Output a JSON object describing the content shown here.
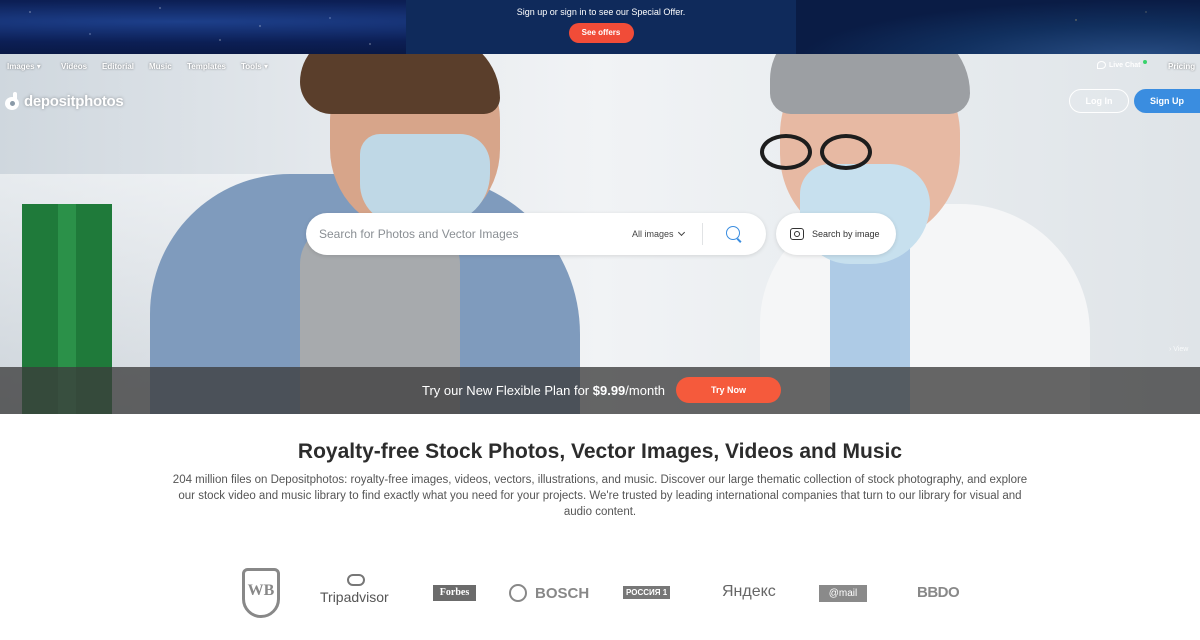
{
  "promo": {
    "text": "Sign up or sign in to see our Special Offer.",
    "button_label": "See offers"
  },
  "nav": {
    "items": [
      {
        "label": "Images",
        "dropdown": true
      },
      {
        "label": "Videos",
        "dropdown": false
      },
      {
        "label": "Editorial",
        "dropdown": false
      },
      {
        "label": "Music",
        "dropdown": false
      },
      {
        "label": "Templates",
        "dropdown": false
      },
      {
        "label": "Tools",
        "dropdown": true
      }
    ],
    "live_chat": "Live Chat",
    "pricing": "Pricing"
  },
  "brand": {
    "name": "depositphotos"
  },
  "auth": {
    "login": "Log In",
    "signup": "Sign Up"
  },
  "search": {
    "placeholder": "Search for Photos and Vector Images",
    "filter_value": "All images",
    "by_image_label": "Search by image"
  },
  "hero": {
    "view_link": "View"
  },
  "plan_bar": {
    "text_prefix": "Try our New Flexible Plan for ",
    "price": "$9.99",
    "text_suffix": "/month",
    "button_label": "Try Now"
  },
  "content": {
    "headline": "Royalty-free Stock Photos, Vector Images, Videos and Music",
    "description": "204 million files on Depositphotos: royalty-free images, videos, vectors, illustrations, and music. Discover our large thematic collection of stock photography, and explore our stock video and music library to find exactly what you need for your projects. We're trusted by leading international companies that turn to our library for visual and audio content."
  },
  "partners": {
    "warner": "WB",
    "tripadvisor": "Tripadvisor",
    "forbes": "Forbes",
    "bosch": "BOSCH",
    "rossiya": "РОССИЯ 1",
    "yandex": "Яндекс",
    "mail": "@mail",
    "bbdo": "BBDO"
  },
  "colors": {
    "accent_blue": "#3a8de0",
    "cta_orange": "#f55a3c",
    "promo_navy": "#0f2a5b",
    "live_dot": "#38d36c"
  }
}
